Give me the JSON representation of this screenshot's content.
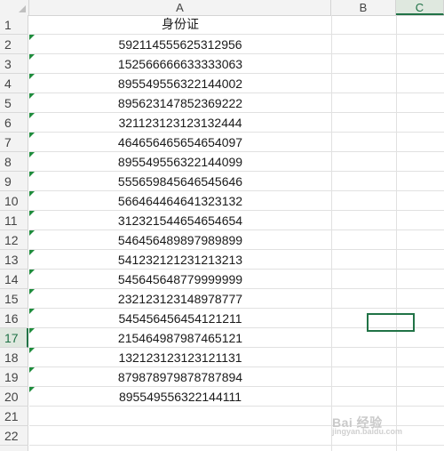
{
  "columns": [
    {
      "label": "A",
      "selected": false
    },
    {
      "label": "B",
      "selected": false
    },
    {
      "label": "C",
      "selected": true
    }
  ],
  "rows": [
    {
      "num": "1",
      "value": "身份证"
    },
    {
      "num": "2",
      "value": "592114555625312956"
    },
    {
      "num": "3",
      "value": "152566666633333063"
    },
    {
      "num": "4",
      "value": "895549556322144002"
    },
    {
      "num": "5",
      "value": "895623147852369222"
    },
    {
      "num": "6",
      "value": "321123123123132444"
    },
    {
      "num": "7",
      "value": "464656465654654097"
    },
    {
      "num": "8",
      "value": "895549556322144099"
    },
    {
      "num": "9",
      "value": "555659845646545646"
    },
    {
      "num": "10",
      "value": "566464464641323132"
    },
    {
      "num": "11",
      "value": "312321544654654654"
    },
    {
      "num": "12",
      "value": "546456489897989899"
    },
    {
      "num": "13",
      "value": "541232121231213213"
    },
    {
      "num": "14",
      "value": "545645648779999999"
    },
    {
      "num": "15",
      "value": "232123123148978777"
    },
    {
      "num": "16",
      "value": "545456456454121211"
    },
    {
      "num": "17",
      "value": "215464987987465121"
    },
    {
      "num": "18",
      "value": "132123123123121131"
    },
    {
      "num": "19",
      "value": "879878979878787894"
    },
    {
      "num": "20",
      "value": "895549556322144111"
    },
    {
      "num": "21",
      "value": ""
    },
    {
      "num": "22",
      "value": ""
    }
  ],
  "active_row": "17",
  "active_column": "C",
  "watermark": {
    "text": "Bai 经验",
    "sub": "jingyan.baidu.com"
  },
  "colors": {
    "accent": "#217346",
    "grid": "#e1e1e1",
    "header_bg": "#f3f3f3"
  }
}
